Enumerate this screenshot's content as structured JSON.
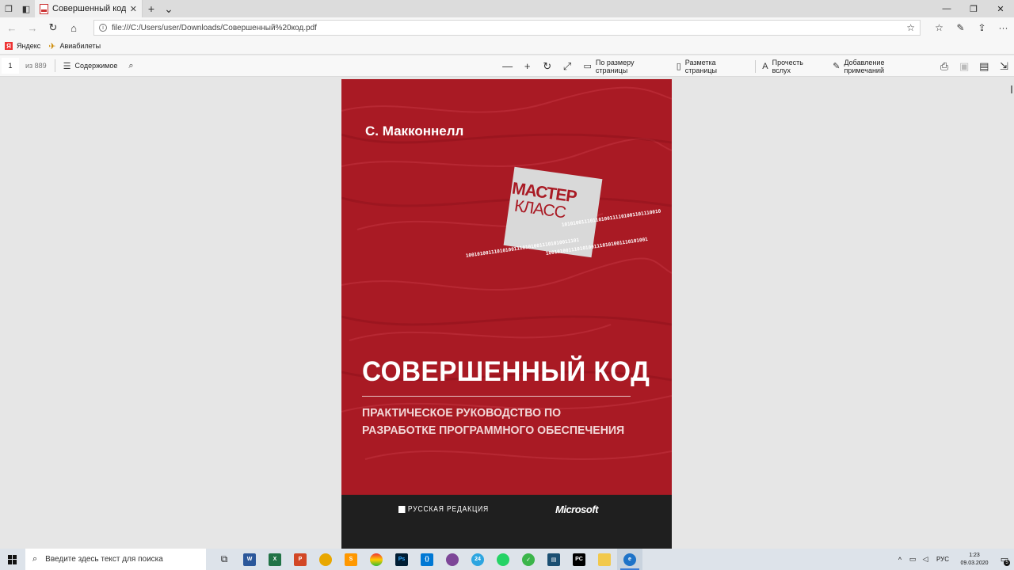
{
  "browser": {
    "tab": {
      "title": "Совершенный код.pdf",
      "close": "✕"
    },
    "address": {
      "url": "file:///C:/Users/user/Downloads/Совершенный%20код.pdf"
    },
    "favorites": [
      {
        "label": "Яндекс",
        "icon": "yandex-icon"
      },
      {
        "label": "Авиабилеты",
        "icon": "plane-icon"
      }
    ]
  },
  "pdf_toolbar": {
    "page_current": "1",
    "page_total": "из 889",
    "contents_label": "Содержимое",
    "fit_page_label": "По размеру страницы",
    "page_layout_label": "Разметка страницы",
    "read_aloud_label": "Прочесть вслух",
    "add_notes_label": "Добавление примечаний"
  },
  "book": {
    "author": "С. Макконнелл",
    "badge_line1": "МАСТЕР",
    "badge_line2": "КЛАСС",
    "binary_1": "10101001110110100111101001101110010",
    "binary_2": "1001010011101010011101010011101010011101",
    "binary_3": "100101001110101001110101001110101001",
    "title": "СОВЕРШЕННЫЙ КОД",
    "subtitle": "ПРАКТИЧЕСКОЕ РУКОВОДСТВО ПО РАЗРАБОТКЕ ПРОГРАММНОГО ОБЕСПЕЧЕНИЯ",
    "publisher": "РУССКАЯ РЕДАКЦИЯ",
    "brand": "Microsoft",
    "cover_color": "#a91a24"
  },
  "taskbar": {
    "search_placeholder": "Введите здесь текст для поиска",
    "language": "РУС",
    "time": "1:23",
    "date": "09.03.2020",
    "notifications": "5"
  }
}
